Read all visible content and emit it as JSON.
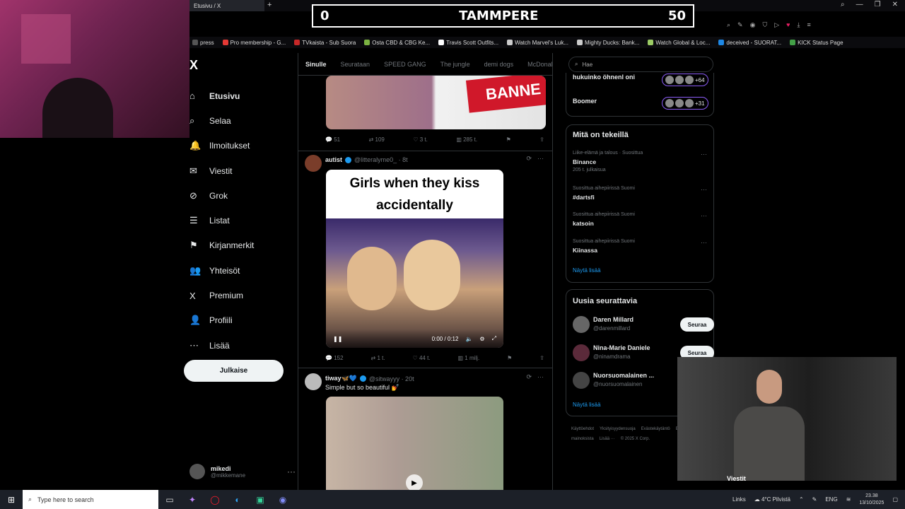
{
  "browser": {
    "tab_title": "Etusivu / X",
    "new_tab": "+",
    "window_controls": [
      "⌕",
      "—",
      "❐",
      "✕"
    ],
    "bookmarks": [
      {
        "label": "press",
        "color": "#555"
      },
      {
        "label": "Pro membership - G...",
        "color": "#e53935"
      },
      {
        "label": "TVkaista - Sub Suora",
        "color": "#c62828"
      },
      {
        "label": "Osta CBD & CBG Ke...",
        "color": "#7cb342"
      },
      {
        "label": "Travis Scott Outfits...",
        "color": "#fff"
      },
      {
        "label": "Watch Marvel's Luk...",
        "color": "#ccc"
      },
      {
        "label": "Mighty Ducks: Bank...",
        "color": "#ccc"
      },
      {
        "label": "Watch Global & Loc...",
        "color": "#9ccc65"
      },
      {
        "label": "deceived - SUORAT...",
        "color": "#1e88e5"
      },
      {
        "label": "KICK Status Page",
        "color": "#43a047"
      }
    ]
  },
  "scoreboard": {
    "left": "0",
    "center": "TAMMPERE",
    "right": "50"
  },
  "nav": {
    "logo": "X",
    "items": [
      {
        "label": "Etusivu",
        "icon": "⌂",
        "active": true
      },
      {
        "label": "Selaa",
        "icon": "⌕"
      },
      {
        "label": "Ilmoitukset",
        "icon": "🔔"
      },
      {
        "label": "Viestit",
        "icon": "✉"
      },
      {
        "label": "Grok",
        "icon": "⊘"
      },
      {
        "label": "Listat",
        "icon": "☰"
      },
      {
        "label": "Kirjanmerkit",
        "icon": "⚑"
      },
      {
        "label": "Yhteisöt",
        "icon": "👥"
      },
      {
        "label": "Premium",
        "icon": "X"
      },
      {
        "label": "Profiili",
        "icon": "👤"
      },
      {
        "label": "Lisää",
        "icon": "⋯"
      }
    ],
    "post_button": "Julkaise",
    "profile": {
      "name": "mikedi",
      "handle": "@mikkemane",
      "more": "···"
    }
  },
  "feed": {
    "tabs": [
      "Sinulle",
      "Seurataan",
      "SPEED GANG",
      "The jungle",
      "demi dogs",
      "McDonal"
    ],
    "post1": {
      "banner_text": "BANNE",
      "actions": {
        "replies": "51",
        "reposts": "109",
        "likes": "3 t.",
        "views": "285 t."
      }
    },
    "post2": {
      "name": "autist",
      "handle": "@litteralyme0_ · 8t",
      "caption": "Girls when they kiss accidentally",
      "video_time": "0:00 / 0:12",
      "actions": {
        "replies": "152",
        "reposts": "1 t.",
        "likes": "44 t.",
        "views": "1 milj."
      }
    },
    "post3": {
      "name": "tiway🦋💙",
      "handle": "@sitwayyy · 20t",
      "text": "Simple but so beautiful 💅"
    }
  },
  "right": {
    "search_placeholder": "Hae",
    "spaces": [
      {
        "title": "hukuinko öhnenl oni",
        "count": "+64"
      },
      {
        "title": "Boomer",
        "count": "+31"
      }
    ],
    "trends_title": "Mitä on tekeillä",
    "trends": [
      {
        "context": "Liike-elämä ja talous · Suosittua",
        "name": "Binance",
        "count": "205 t. julkaisua"
      },
      {
        "context": "Suosittua aihepiirissä Suomi",
        "name": "#dartsfi",
        "count": ""
      },
      {
        "context": "Suosittua aihepiirissä Suomi",
        "name": "katsoin",
        "count": ""
      },
      {
        "context": "Suosittua aihepiirissä Suomi",
        "name": "Kiinassa",
        "count": ""
      }
    ],
    "trends_more": "Näytä lisää",
    "who_title": "Uusia seurattavia",
    "who": [
      {
        "name": "Daren Millard",
        "handle": "@darenmillard",
        "button": "Seuraa"
      },
      {
        "name": "Nina-Marie Daniele",
        "handle": "@ninamdrama",
        "button": "Seuraa"
      },
      {
        "name": "Nuorsuomalainen ...",
        "handle": "@nuorsuomalainen",
        "button": "Seuraa"
      }
    ],
    "who_more": "Näytä lisää",
    "footer": [
      "Käyttöehdot",
      "Yksityisyydensuoja",
      "Evästekäytäntö",
      "Esteettömyys",
      "Tietoa mainoksista",
      "Lisää ···",
      "© 2025 X Corp."
    ]
  },
  "overlay_label": "Viestit",
  "taskbar": {
    "search_placeholder": "Type here to search",
    "links": "Links",
    "weather": "4°C Pilvistä",
    "lang": "ENG",
    "time": "23.38",
    "date": "13/10/2025"
  }
}
